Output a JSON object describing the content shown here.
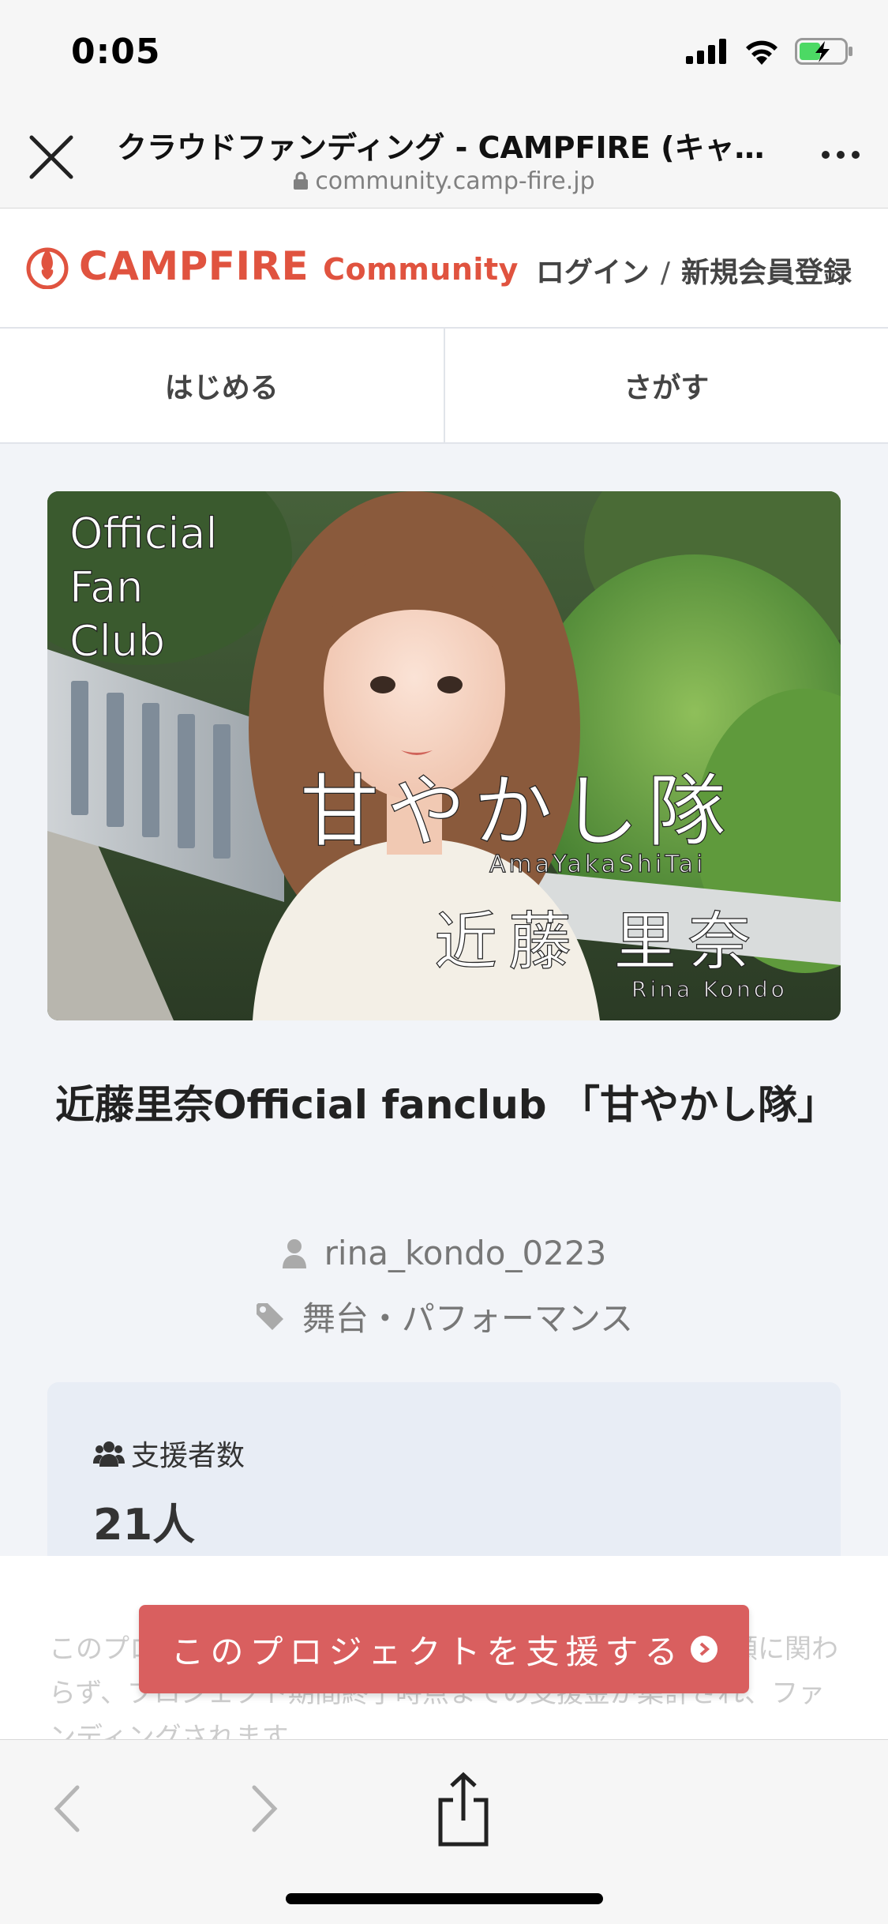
{
  "status_bar": {
    "time": "0:05",
    "icons": [
      "cellular-icon",
      "wifi-icon",
      "battery-charging-icon"
    ]
  },
  "browser": {
    "title": "クラウドファンディング - CAMPFIRE (キャ…",
    "url": "community.camp-fire.jp"
  },
  "site_header": {
    "logo_main": "CAMPFIRE",
    "logo_sub": "Community",
    "login": "ログイン",
    "separator": "/",
    "register": "新規会員登録"
  },
  "nav": {
    "start": "はじめる",
    "search": "さがす"
  },
  "hero": {
    "text_official": "Official",
    "text_fan": "Fan",
    "text_club": "Club",
    "text_amayakashi": "甘やかし隊",
    "text_amayakashi_romaji": "AmaYakaShiTai",
    "text_name": "近藤 里奈",
    "text_name_romaji": "Rina Kondo"
  },
  "project": {
    "title": "近藤里奈Official fanclub 「甘やかし隊」",
    "owner": "rina_kondo_0223",
    "category": "舞台・パフォーマンス"
  },
  "stats": {
    "supporters_label": "支援者数",
    "supporters_value": "21人"
  },
  "cta": {
    "ghost_text": "このプロジェクトは、All-in方式で実施されます。目標金額に関わらず、プロジェクト期間終了時点までの支援金が集計され、ファンディングされます。",
    "button_label": "このプロジェクトを支援する"
  },
  "colors": {
    "brand": "#e0533f",
    "cta": "#d95f5f",
    "card": "#e8edf5"
  }
}
